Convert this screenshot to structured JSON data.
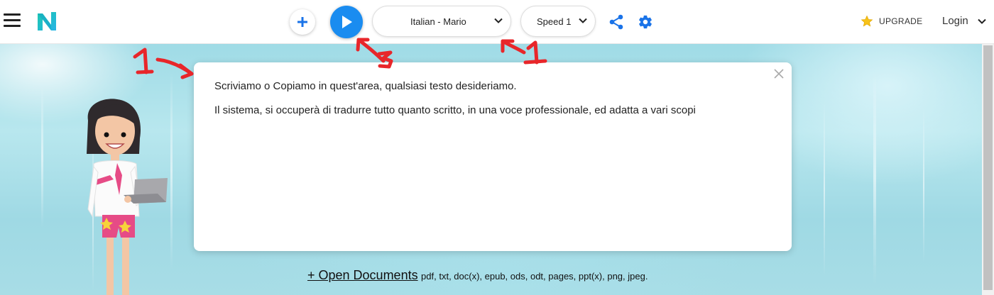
{
  "header": {
    "voice": "Italian - Mario",
    "speed": "Speed 1",
    "upgrade_label": "UPGRADE",
    "login_label": "Login"
  },
  "editor": {
    "paragraphs": [
      "Scriviamo o Copiamo in quest'area, qualsiasi testo desideriamo.",
      "Il sistema, si occuperà di tradurre tutto quanto scritto, in una voce professionale,  ed adatta a vari scopi"
    ]
  },
  "open_documents": {
    "link_label": "+ Open Documents",
    "formats": "pdf, txt, doc(x), epub, ods, odt, pages, ppt(x), png, jpeg."
  },
  "annotations": {
    "label_1": "1",
    "label_3": "3",
    "color": "#e8262a"
  },
  "colors": {
    "accent": "#1a8cf0",
    "logo_teal": "#19c6a8"
  }
}
